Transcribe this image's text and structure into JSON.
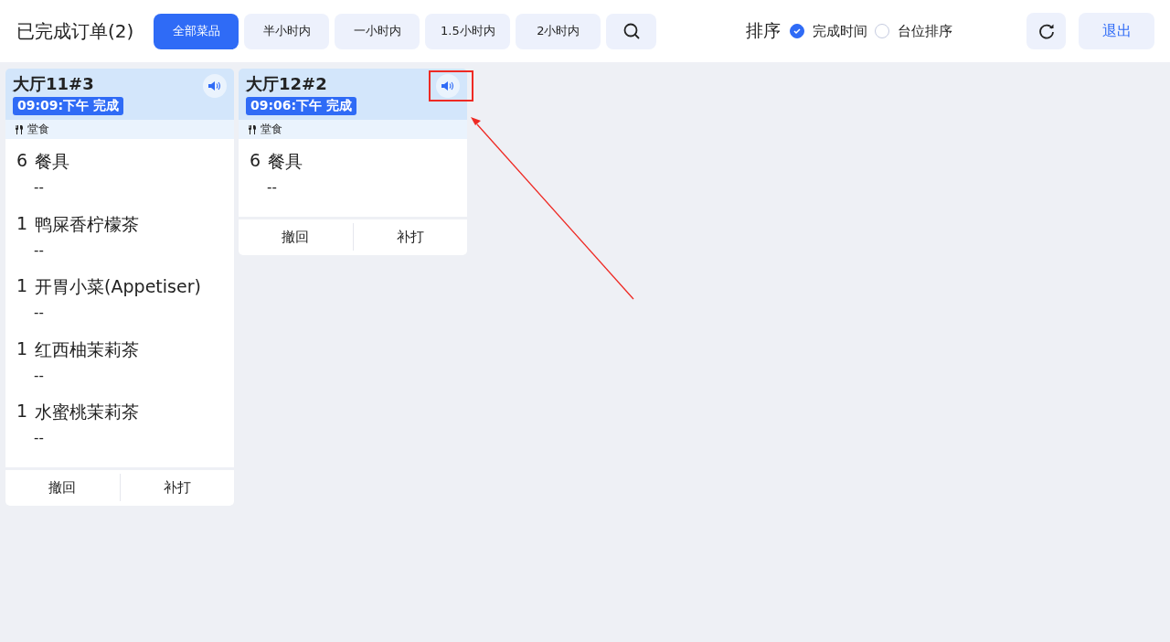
{
  "header": {
    "title": "已完成订单(2)",
    "filters": [
      {
        "label": "全部菜品",
        "selected": true
      },
      {
        "label": "半小时内",
        "selected": false
      },
      {
        "label": "一小时内",
        "selected": false
      },
      {
        "label": "1.5小时内",
        "selected": false
      },
      {
        "label": "2小时内",
        "selected": false
      }
    ],
    "sort": {
      "label": "排序",
      "options": [
        {
          "label": "完成时间",
          "selected": true
        },
        {
          "label": "台位排序",
          "selected": false
        }
      ]
    },
    "exit_button": "退出"
  },
  "orders": [
    {
      "table": "大厅11#3",
      "status": "09:09:下午 完成",
      "dining_type": "堂食",
      "items": [
        {
          "qty": "6",
          "name": "餐具",
          "note": "--"
        },
        {
          "qty": "1",
          "name": "鸭屎香柠檬茶",
          "note": "--"
        },
        {
          "qty": "1",
          "name": "开胃小菜(Appetiser)",
          "note": "--"
        },
        {
          "qty": "1",
          "name": "红西柚茉莉茶",
          "note": "--"
        },
        {
          "qty": "1",
          "name": "水蜜桃茉莉茶",
          "note": "--"
        }
      ],
      "actions": [
        "撤回",
        "补打"
      ]
    },
    {
      "table": "大厅12#2",
      "status": "09:06:下午 完成",
      "dining_type": "堂食",
      "items": [
        {
          "qty": "6",
          "name": "餐具",
          "note": "--"
        }
      ],
      "actions": [
        "撤回",
        "补打"
      ]
    }
  ]
}
